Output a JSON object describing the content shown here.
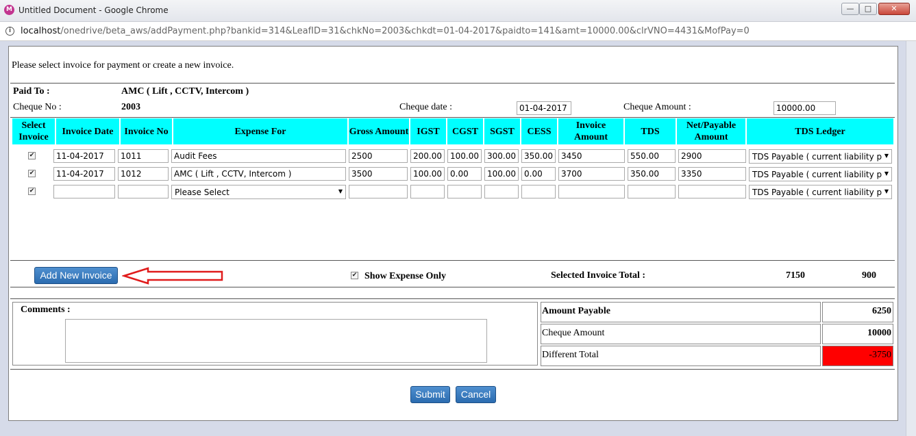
{
  "window": {
    "title": "Untitled Document - Google Chrome",
    "icon_letter": "M",
    "minimize": "—",
    "maximize": "□",
    "close": "✕"
  },
  "address": {
    "host": "localhost",
    "path": "/onedrive/beta_aws/addPayment.php?bankid=314&LeafID=31&chkNo=2003&chkdt=01-04-2017&paidto=141&amt=10000.00&clrVNO=4431&MofPay=0"
  },
  "page": {
    "intro": "Please select invoice for payment or create a new invoice.",
    "paid_to_label": "Paid To :",
    "paid_to_value": "AMC ( Lift , CCTV, Intercom )",
    "cheque_no_label": "Cheque No :",
    "cheque_no_value": "2003",
    "cheque_date_label": "Cheque date :",
    "cheque_date_value": "01-04-2017",
    "cheque_amount_label": "Cheque Amount :",
    "cheque_amount_value": "10000.00"
  },
  "table": {
    "headers": {
      "select": "Select Invoice",
      "date": "Invoice Date",
      "no": "Invoice No",
      "expense": "Expense For",
      "gross": "Gross Amount",
      "igst": "IGST",
      "cgst": "CGST",
      "sgst": "SGST",
      "cess": "CESS",
      "invamt": "Invoice Amount",
      "tds": "TDS",
      "net": "Net/Payable Amount",
      "ledger": "TDS Ledger"
    },
    "rows": [
      {
        "checked": "✔",
        "date": "11-04-2017",
        "no": "1011",
        "expense": "Audit Fees",
        "gross": "2500",
        "igst": "200.00",
        "cgst": "100.00",
        "sgst": "300.00",
        "cess": "350.00",
        "invamt": "3450",
        "tds": "550.00",
        "net": "2900",
        "ledger": "TDS Payable ( current liability p"
      },
      {
        "checked": "✔",
        "date": "11-04-2017",
        "no": "1012",
        "expense": "AMC ( Lift , CCTV, Intercom )",
        "gross": "3500",
        "igst": "100.00",
        "cgst": "0.00",
        "sgst": "100.00",
        "cess": "0.00",
        "invamt": "3700",
        "tds": "350.00",
        "net": "3350",
        "ledger": "TDS Payable ( current liability p"
      },
      {
        "checked": "✔",
        "date": "",
        "no": "",
        "expense": "Please Select",
        "gross": "",
        "igst": "",
        "cgst": "",
        "sgst": "",
        "cess": "",
        "invamt": "",
        "tds": "",
        "net": "",
        "ledger": "TDS Payable ( current liability p"
      }
    ]
  },
  "actions": {
    "add_invoice": "Add New Invoice",
    "show_expense_check": "✔",
    "show_expense_label": "Show Expense Only",
    "selected_total_label": "Selected Invoice Total :",
    "selected_total_amount": "7150",
    "selected_total_tds": "900"
  },
  "summary": {
    "comments_label": "Comments :",
    "rows": [
      {
        "label": "Amount Payable",
        "value": "6250"
      },
      {
        "label": "Cheque Amount",
        "value": "10000"
      },
      {
        "label": "Different Total",
        "value": "-3750"
      }
    ],
    "diff_color": "#ff0000"
  },
  "buttons": {
    "submit": "Submit",
    "cancel": "Cancel"
  },
  "colors": {
    "header_bg": "#00ffff",
    "button_blue": "#2b6cb0",
    "arrow_red": "#e01b1b"
  }
}
